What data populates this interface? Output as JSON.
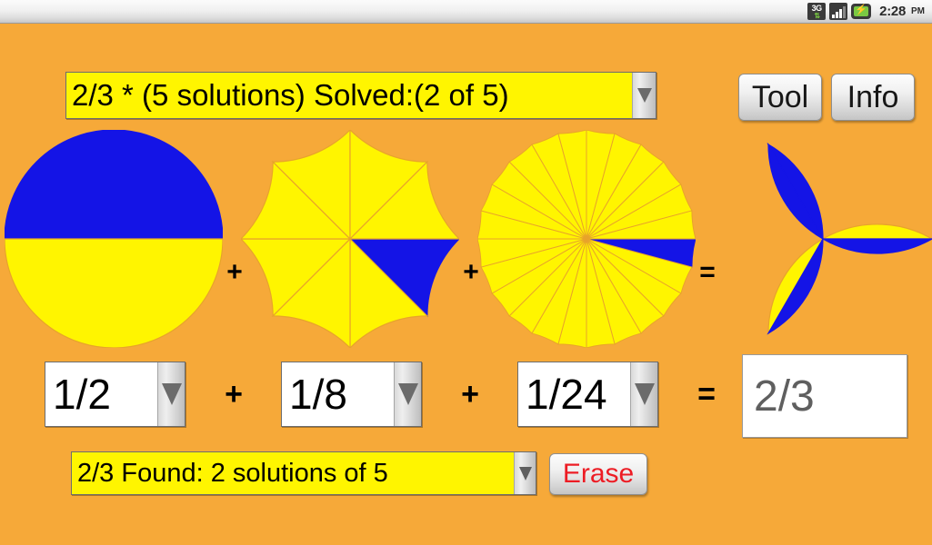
{
  "status_bar": {
    "network_label": "3G",
    "network_arrows": "⇅",
    "time": "2:28",
    "ampm": "PM",
    "battery_glyph": "⚡",
    "icons": [
      "3g-icon",
      "signal-icon",
      "battery-icon"
    ]
  },
  "header": {
    "problem_spinner": "2/3 * (5 solutions) Solved:(2 of 5)",
    "tool_label": "Tool",
    "info_label": "Info"
  },
  "footer": {
    "status_spinner": "2/3 Found: 2 solutions of 5",
    "erase_label": "Erase"
  },
  "equation": {
    "operators": [
      "+",
      "+",
      "="
    ],
    "terms": [
      {
        "value": "1/2",
        "denominator": 2,
        "highlighted": 1
      },
      {
        "value": "1/8",
        "denominator": 8,
        "highlighted": 1
      },
      {
        "value": "1/24",
        "denominator": 24,
        "highlighted": 1
      }
    ],
    "result": {
      "value": "2/3",
      "denominator": 3,
      "highlighted": 2
    }
  },
  "colors": {
    "background": "#F6A939",
    "pie_fill": "#FFF500",
    "pie_highlight": "#1414E6",
    "pie_divider": "#E8A32B",
    "spinner_yellow": "#FFF500",
    "erase_text": "#ED1C24",
    "result_text": "#5F5F5F"
  }
}
